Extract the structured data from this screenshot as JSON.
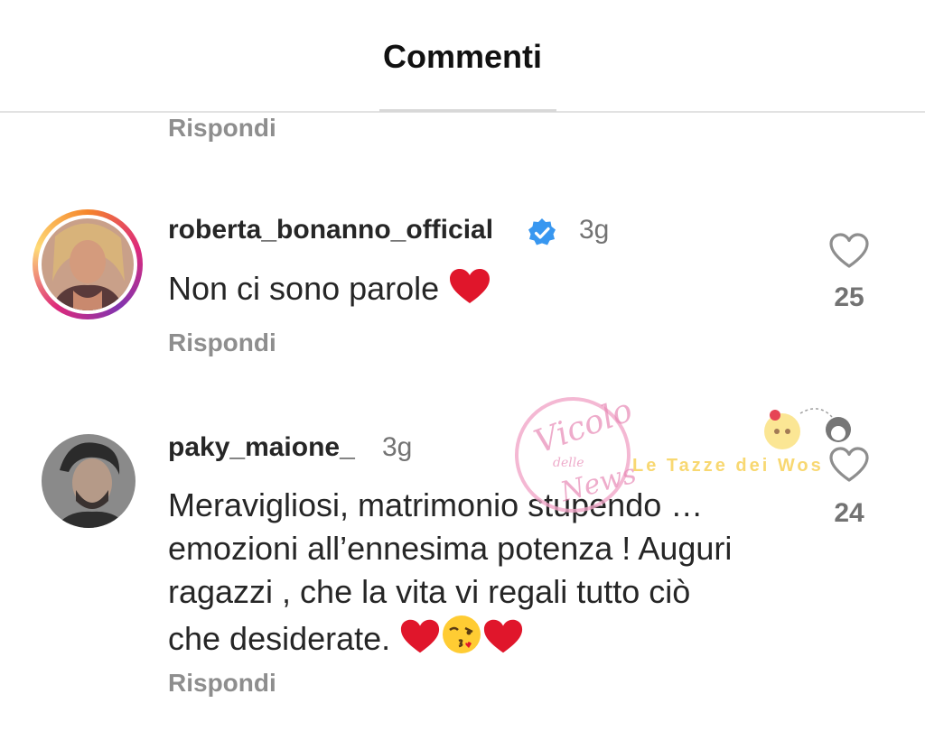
{
  "header": {
    "title": "Commenti"
  },
  "reply_label": "Rispondi",
  "comments": [
    {
      "username": "roberta_bonanno_official",
      "verified": true,
      "time": "3g",
      "text": "Non ci sono parole",
      "likes": "25"
    },
    {
      "username": "paky_maione_",
      "verified": false,
      "time": "3g",
      "text_lines": [
        "Meravigliosi, matrimonio stupendo …",
        "emozioni all’ennesima potenza ! Auguri",
        "ragazzi , che la vita vi regali tutto ciò",
        "che desiderate."
      ],
      "likes": "24"
    }
  ],
  "watermark": {
    "line1": "Vicolo",
    "line2": "delle",
    "line3": "News",
    "banner": "Le Tazze dei Wos"
  },
  "colors": {
    "verified": "#3897f0",
    "heart_red": "#e0162b",
    "secondary_text": "#8e8e8e"
  }
}
